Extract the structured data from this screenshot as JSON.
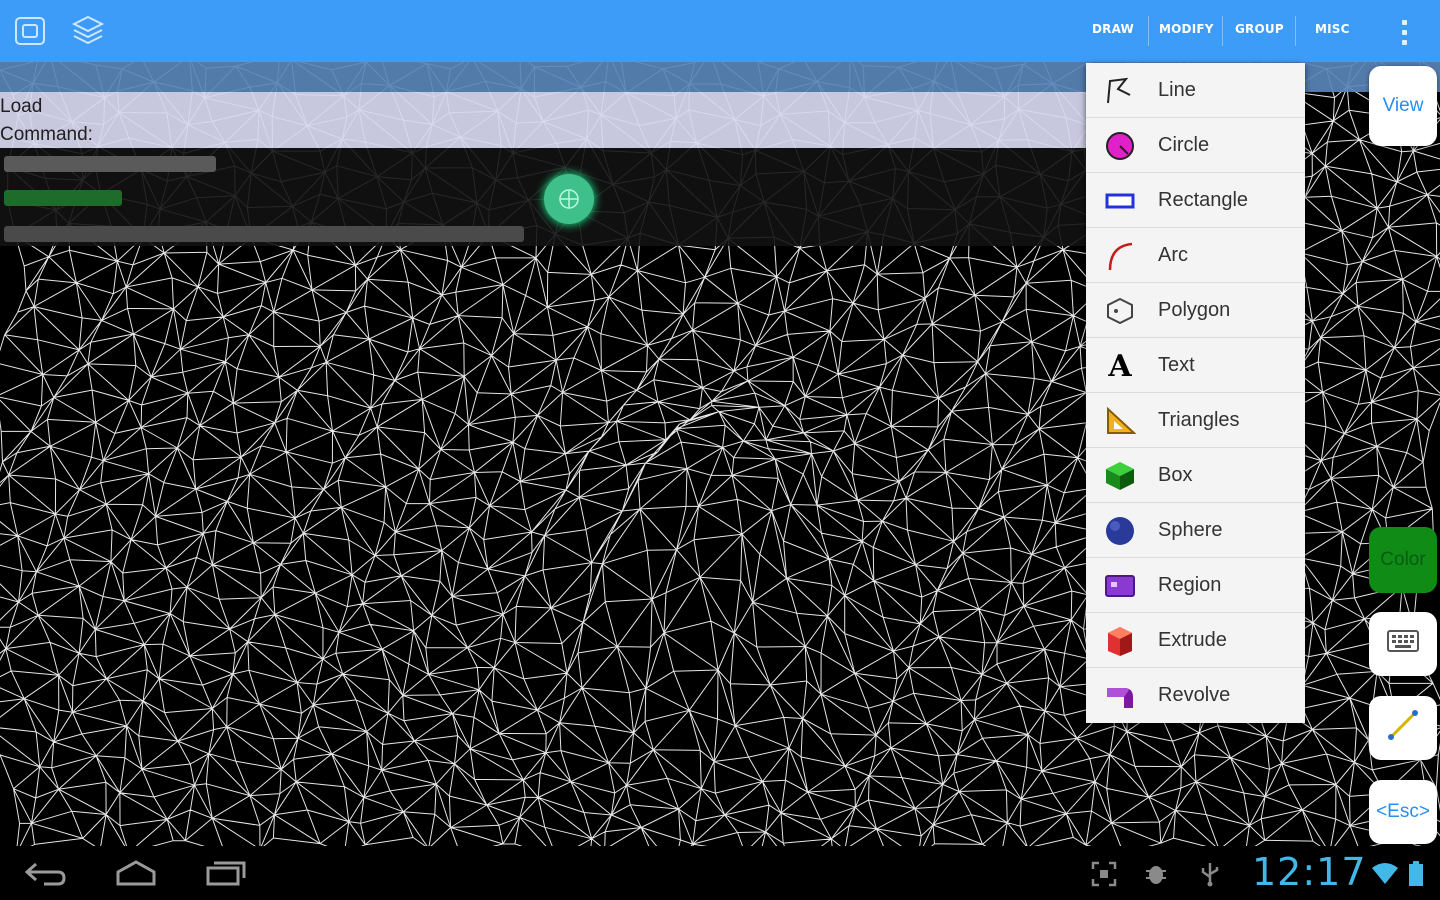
{
  "action_bar": {
    "background": "#3d9cf7",
    "left_icons": [
      "app-window-icon",
      "layers-icon"
    ],
    "menus": [
      "DRAW",
      "MODIFY",
      "GROUP",
      "MISC"
    ],
    "overflow_icon": "overflow-menu-icon"
  },
  "command_panel": {
    "line1": "Load",
    "line2": "Command:"
  },
  "draw_menu": {
    "items": [
      {
        "label": "Line",
        "icon": "line-icon"
      },
      {
        "label": "Circle",
        "icon": "circle-icon"
      },
      {
        "label": "Rectangle",
        "icon": "rectangle-icon"
      },
      {
        "label": "Arc",
        "icon": "arc-icon"
      },
      {
        "label": "Polygon",
        "icon": "polygon-icon"
      },
      {
        "label": "Text",
        "icon": "text-icon"
      },
      {
        "label": "Triangles",
        "icon": "triangles-icon"
      },
      {
        "label": "Box",
        "icon": "box-icon"
      },
      {
        "label": "Sphere",
        "icon": "sphere-icon"
      },
      {
        "label": "Region",
        "icon": "region-icon"
      },
      {
        "label": "Extrude",
        "icon": "extrude-icon"
      },
      {
        "label": "Revolve",
        "icon": "revolve-icon"
      }
    ]
  },
  "side_buttons": {
    "view": "View",
    "color": "Color",
    "keyboard_icon": "keyboard-icon",
    "line_tool_icon": "line-tool-icon",
    "esc": "<Esc>"
  },
  "status_bar": {
    "time": "12:17",
    "nav_icons": [
      "back-icon",
      "home-icon",
      "recent-apps-icon"
    ],
    "notification_icons": [
      "screenshot-icon",
      "debug-icon",
      "usb-icon",
      "wifi-icon",
      "battery-icon"
    ]
  },
  "colors": {
    "accent": "#3d9cf7",
    "mesh": "#e6e6e6",
    "clock": "#41b8e8",
    "color_button": "#0f8b16"
  }
}
